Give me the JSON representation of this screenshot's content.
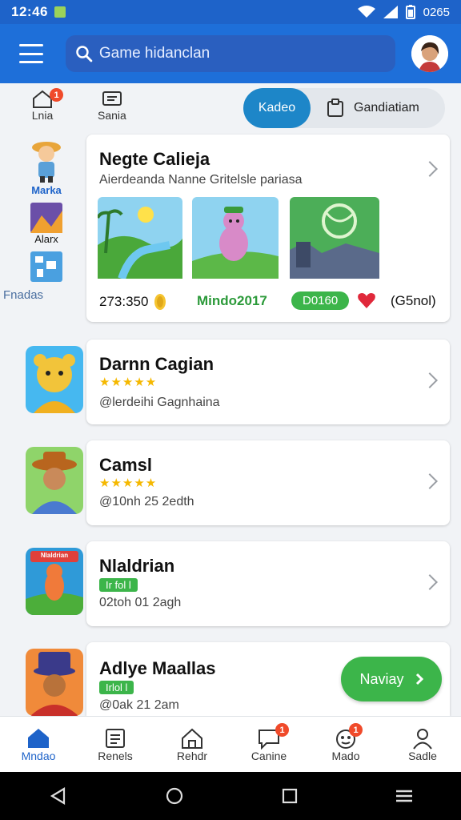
{
  "status": {
    "time": "12:46",
    "battery": "0265"
  },
  "header": {
    "search_placeholder": "Game hidanclan"
  },
  "topnav": {
    "items": [
      {
        "label": "Lnia",
        "badge": "1"
      },
      {
        "label": "Sania"
      }
    ],
    "toggle": {
      "active": "Kadeo",
      "inactive": "Gandiatiam"
    }
  },
  "sidebar": {
    "items": [
      {
        "label": "Marka"
      },
      {
        "label": "Alarx"
      }
    ],
    "section_label": "Fnadas"
  },
  "featured": {
    "title": "Negte Calieja",
    "subtitle": "Aierdeanda Nanne Gritelsle pariasa",
    "score": "273:350",
    "tag": "Mindo2017",
    "pill": "D0160",
    "count": "(G5nol)"
  },
  "games": [
    {
      "title": "Darnn Cagian",
      "stars": "★★★★★",
      "meta": "@lerdeihi Gagnhaina"
    },
    {
      "title": "Camsl",
      "stars": "★★★★★",
      "meta": "@10nh 25 2edth"
    },
    {
      "title": "Nlaldrian",
      "pill": "Ir fol l",
      "meta": "02toh 01 2agh",
      "icon_label": "Nlaldrian"
    },
    {
      "title": "Adlye Maallas",
      "pill": "Irlol l",
      "meta": "@0ak 21 2am",
      "action": "Naviay"
    }
  ],
  "bottomnav": {
    "items": [
      {
        "label": "Mndao",
        "active": true
      },
      {
        "label": "Renels"
      },
      {
        "label": "Rehdr"
      },
      {
        "label": "Canine",
        "badge": "1"
      },
      {
        "label": "Mado",
        "badge": "1"
      },
      {
        "label": "Sadle"
      }
    ]
  },
  "colors": {
    "brand": "#1e6fd9",
    "accent": "#3cb54a",
    "badge": "#f04a2a"
  }
}
